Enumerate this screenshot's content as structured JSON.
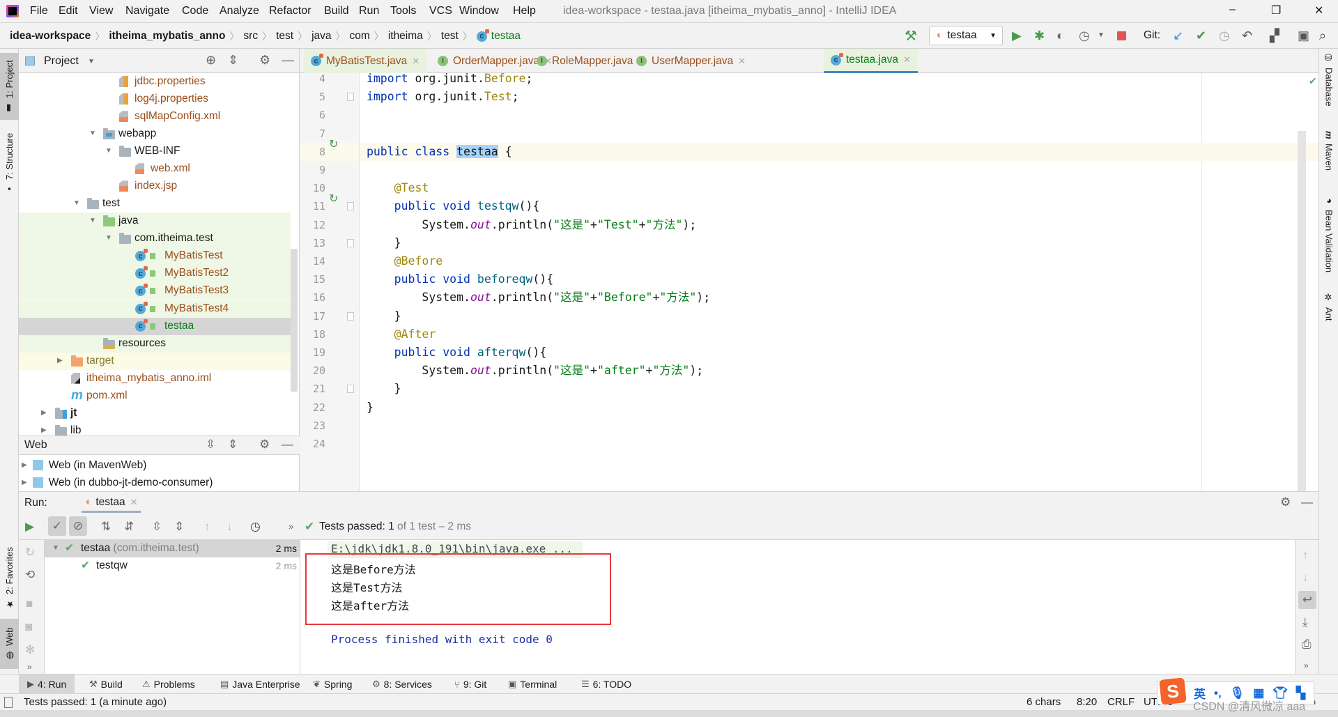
{
  "colors": {
    "accent": "#4083c9",
    "passed": "#59a869",
    "highlight_box": "#e8383d",
    "added_file": "#067d17",
    "unversioned_file": "#9b4f1b"
  },
  "titlebar": {
    "menus": [
      "File",
      "Edit",
      "View",
      "Navigate",
      "Code",
      "Analyze",
      "Refactor",
      "Build",
      "Run",
      "Tools",
      "VCS",
      "Window",
      "Help"
    ],
    "title": "idea-workspace - testaa.java [itheima_mybatis_anno] - IntelliJ IDEA",
    "controls": {
      "minimize": "–",
      "maximize": "❐",
      "close": "✕"
    }
  },
  "navbar": {
    "breadcrumb": [
      "idea-workspace",
      "itheima_mybatis_anno",
      "src",
      "test",
      "java",
      "com",
      "itheima",
      "test",
      "testaa"
    ],
    "run_config": "testaa",
    "git_label": "Git:"
  },
  "left_strip": {
    "project": "1: Project",
    "structure": "7: Structure",
    "favorites": "2: Favorites",
    "web": "Web"
  },
  "right_strip": [
    "Database",
    "Maven",
    "Bean Validation",
    "Ant"
  ],
  "project": {
    "title": "Project",
    "tree": [
      {
        "label": "jdbc.properties",
        "level": 4,
        "leaf": true,
        "icon": "properties-file",
        "color": "#9b4f1b"
      },
      {
        "label": "log4j.properties",
        "level": 4,
        "leaf": true,
        "icon": "properties-file",
        "color": "#9b4f1b"
      },
      {
        "label": "sqlMapConfig.xml",
        "level": 4,
        "leaf": true,
        "icon": "xml-file",
        "color": "#9b4f1b"
      },
      {
        "label": "webapp",
        "level": 3,
        "leaf": false,
        "icon": "web-folder",
        "color": "#1a1a1a"
      },
      {
        "label": "WEB-INF",
        "level": 4,
        "leaf": false,
        "icon": "folder",
        "color": "#1a1a1a"
      },
      {
        "label": "web.xml",
        "level": 5,
        "leaf": true,
        "icon": "web-xml-file",
        "color": "#9b4f1b"
      },
      {
        "label": "index.jsp",
        "level": 4,
        "leaf": true,
        "icon": "jsp-file",
        "color": "#9b4f1b"
      },
      {
        "label": "test",
        "level": 2,
        "leaf": false,
        "icon": "folder",
        "color": "#1a1a1a"
      },
      {
        "label": "java",
        "level": 3,
        "leaf": false,
        "icon": "test-source-folder",
        "color": "#1a1a1a",
        "bg": "#eff8e6"
      },
      {
        "label": "com.itheima.test",
        "level": 4,
        "leaf": false,
        "icon": "package",
        "color": "#1a1a1a",
        "bg": "#eff8e6"
      },
      {
        "label": "MyBatisTest",
        "level": 5,
        "leaf": true,
        "icon": "test-class",
        "color": "#9b4f1b",
        "bg": "#eff8e6"
      },
      {
        "label": "MyBatisTest2",
        "level": 5,
        "leaf": true,
        "icon": "test-class",
        "color": "#9b4f1b",
        "bg": "#eff8e6"
      },
      {
        "label": "MyBatisTest3",
        "level": 5,
        "leaf": true,
        "icon": "test-class",
        "color": "#9b4f1b",
        "bg": "#eff8e6"
      },
      {
        "label": "MyBatisTest4",
        "level": 5,
        "leaf": true,
        "icon": "test-class",
        "color": "#9b4f1b",
        "bg": "#eff8e6"
      },
      {
        "label": "testaa",
        "level": 5,
        "leaf": true,
        "icon": "test-class",
        "color": "#067d17",
        "bg": "#d5d5d5",
        "selected": true
      },
      {
        "label": "resources",
        "level": 3,
        "leaf": true,
        "icon": "resources-folder",
        "color": "#1a1a1a",
        "bg": "#eff8e6"
      },
      {
        "label": "target",
        "level": 1,
        "leaf": false,
        "collapsed": true,
        "icon": "excluded-folder",
        "color": "#857b35",
        "bg": "#fbfbe6"
      },
      {
        "label": "itheima_mybatis_anno.iml",
        "level": 1,
        "leaf": true,
        "icon": "iml-file",
        "color": "#9b4f1b"
      },
      {
        "label": "pom.xml",
        "level": 1,
        "leaf": true,
        "icon": "maven-file",
        "color": "#9b4f1b"
      },
      {
        "label": "jt",
        "level": 0,
        "leaf": false,
        "collapsed": true,
        "icon": "module-folder",
        "color": "#1a1a1a",
        "bold": true
      },
      {
        "label": "lib",
        "level": 0,
        "leaf": false,
        "collapsed": true,
        "icon": "folder",
        "color": "#1a1a1a"
      }
    ]
  },
  "web_panel": {
    "title": "Web",
    "items": [
      "Web (in MavenWeb)",
      "Web (in dubbo-jt-demo-consumer)"
    ]
  },
  "editor": {
    "tabs": [
      {
        "label": "MyBatisTest.java",
        "icon": "test-class",
        "color": "#9b4f1b"
      },
      {
        "label": "OrderMapper.java",
        "icon": "interface",
        "color": "#9b4f1b"
      },
      {
        "label": "RoleMapper.java",
        "icon": "interface",
        "color": "#9b4f1b"
      },
      {
        "label": "UserMapper.java",
        "icon": "interface",
        "color": "#9b4f1b"
      },
      {
        "label": "testaa.java",
        "icon": "test-class",
        "color": "#067d17",
        "active": true
      }
    ],
    "caret_line": 8,
    "lines": [
      {
        "n": "4",
        "seg": [
          [
            "import ",
            "kw"
          ],
          [
            "org.junit.",
            ""
          ],
          [
            "Before",
            "imp"
          ],
          [
            ";",
            ""
          ]
        ]
      },
      {
        "n": "5",
        "seg": [
          [
            "import ",
            "kw"
          ],
          [
            "org.junit.",
            ""
          ],
          [
            "Test",
            "imp"
          ],
          [
            ";",
            ""
          ]
        ]
      },
      {
        "n": "6",
        "seg": []
      },
      {
        "n": "7",
        "seg": []
      },
      {
        "n": "8",
        "seg": [
          [
            "public class ",
            "kw"
          ],
          [
            "testaa",
            "sel"
          ],
          [
            " {",
            ""
          ]
        ]
      },
      {
        "n": "9",
        "seg": []
      },
      {
        "n": "10",
        "seg": [
          [
            "    @Test",
            "ann"
          ]
        ]
      },
      {
        "n": "11",
        "seg": [
          [
            "    public void ",
            "kw"
          ],
          [
            "testqw",
            "mth"
          ],
          [
            "(){",
            ""
          ]
        ]
      },
      {
        "n": "12",
        "seg": [
          [
            "        System.",
            ""
          ],
          [
            "out",
            "fld"
          ],
          [
            ".println(",
            ""
          ],
          [
            "\"这是\"",
            "str"
          ],
          [
            "+",
            ""
          ],
          [
            "\"Test\"",
            "str"
          ],
          [
            "+",
            ""
          ],
          [
            "\"方法\"",
            "str"
          ],
          [
            ");",
            ""
          ]
        ]
      },
      {
        "n": "13",
        "seg": [
          [
            "    }",
            ""
          ]
        ]
      },
      {
        "n": "14",
        "seg": [
          [
            "    @Before",
            "ann"
          ]
        ]
      },
      {
        "n": "15",
        "seg": [
          [
            "    public void ",
            "kw"
          ],
          [
            "beforeqw",
            "mth"
          ],
          [
            "(){",
            ""
          ]
        ]
      },
      {
        "n": "16",
        "seg": [
          [
            "        System.",
            ""
          ],
          [
            "out",
            "fld"
          ],
          [
            ".println(",
            ""
          ],
          [
            "\"这是\"",
            "str"
          ],
          [
            "+",
            ""
          ],
          [
            "\"Before\"",
            "str"
          ],
          [
            "+",
            ""
          ],
          [
            "\"方法\"",
            "str"
          ],
          [
            ");",
            ""
          ]
        ]
      },
      {
        "n": "17",
        "seg": [
          [
            "    }",
            ""
          ]
        ]
      },
      {
        "n": "18",
        "seg": [
          [
            "    @After",
            "ann"
          ]
        ]
      },
      {
        "n": "19",
        "seg": [
          [
            "    public void ",
            "kw"
          ],
          [
            "afterqw",
            "mth"
          ],
          [
            "(){",
            ""
          ]
        ]
      },
      {
        "n": "20",
        "seg": [
          [
            "        System.",
            ""
          ],
          [
            "out",
            "fld"
          ],
          [
            ".println(",
            ""
          ],
          [
            "\"这是\"",
            "str"
          ],
          [
            "+",
            ""
          ],
          [
            "\"after\"",
            "str"
          ],
          [
            "+",
            ""
          ],
          [
            "\"方法\"",
            "str"
          ],
          [
            ");",
            ""
          ]
        ]
      },
      {
        "n": "21",
        "seg": [
          [
            "    }",
            ""
          ]
        ]
      },
      {
        "n": "22",
        "seg": [
          [
            "}",
            ""
          ]
        ]
      },
      {
        "n": "23",
        "seg": []
      },
      {
        "n": "24",
        "seg": []
      }
    ]
  },
  "run": {
    "label": "Run:",
    "tab": "testaa",
    "status_prefix": "Tests passed:",
    "status_count": "1",
    "status_suffix": "of 1 test – 2 ms",
    "tree": [
      {
        "name": "testaa",
        "pkg": "(com.itheima.test)",
        "time": "2 ms"
      },
      {
        "name": "testqw",
        "time": "2 ms"
      }
    ],
    "console": {
      "command": "E:\\jdk\\jdk1.8.0_191\\bin\\java.exe ...",
      "output": [
        "这是Before方法",
        "这是Test方法",
        "这是after方法"
      ],
      "exit": "Process finished with exit code 0"
    }
  },
  "bottom_tabs": [
    {
      "label": "4: Run",
      "icon": "run-icon",
      "active": true
    },
    {
      "label": "Build",
      "icon": "hammer-icon"
    },
    {
      "label": "Problems",
      "icon": "warning-icon"
    },
    {
      "label": "Java Enterprise",
      "icon": "java-enterprise-icon"
    },
    {
      "label": "Spring",
      "icon": "spring-icon"
    },
    {
      "label": "8: Services",
      "icon": "services-icon"
    },
    {
      "label": "9: Git",
      "icon": "git-icon"
    },
    {
      "label": "Terminal",
      "icon": "terminal-icon"
    },
    {
      "label": "6: TODO",
      "icon": "todo-icon"
    }
  ],
  "statusbar": {
    "message": "Tests passed: 1 (a minute ago)",
    "chars": "6 chars",
    "position": "8:20",
    "line_sep": "CRLF",
    "encoding": "UTF-8"
  },
  "ime": {
    "logo": "S",
    "mode": "英",
    "punct": "•,"
  },
  "watermark": "CSDN @清风微凉 aaa"
}
